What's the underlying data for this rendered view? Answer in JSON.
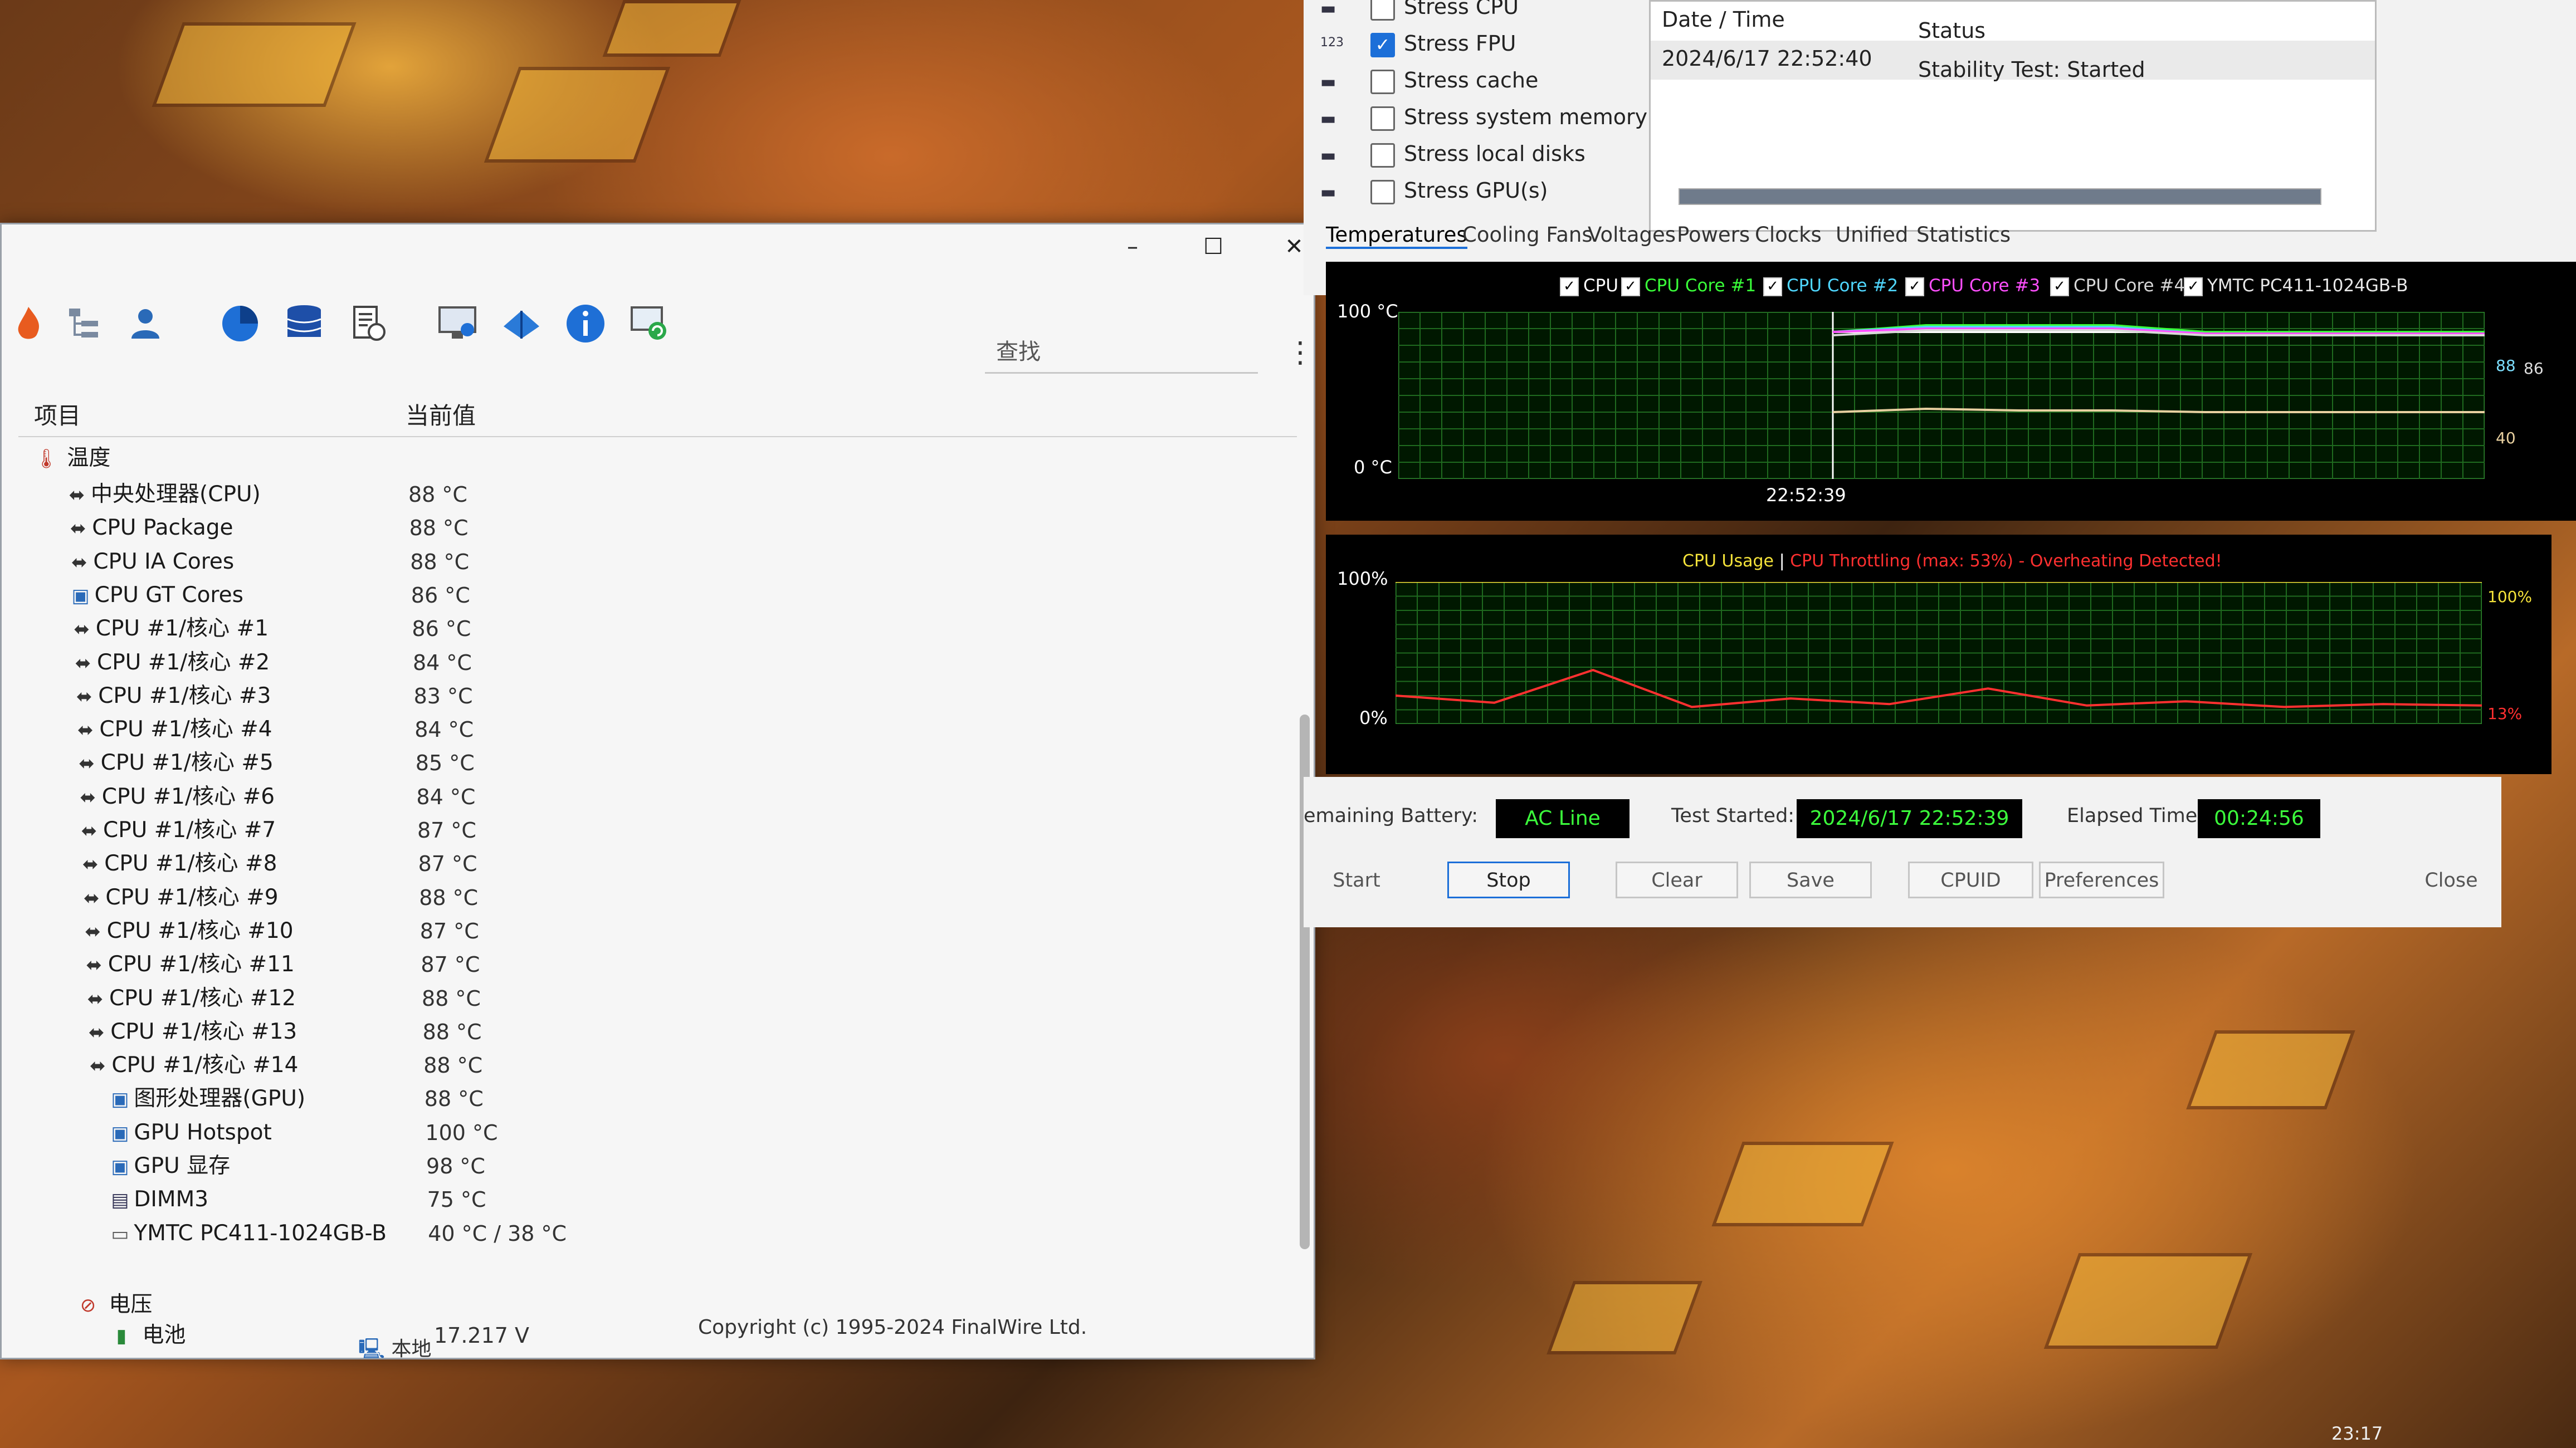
{
  "aida": {
    "search_placeholder": "查找",
    "col_item": "项目",
    "col_value": "当前值",
    "section_temp": "温度",
    "sensors": [
      {
        "label": "中央处理器(CPU)",
        "value": "88 °C",
        "icon": "cpu-icon"
      },
      {
        "label": "CPU Package",
        "value": "88 °C",
        "icon": "cpu-icon"
      },
      {
        "label": "CPU IA Cores",
        "value": "88 °C",
        "icon": "cpu-icon"
      },
      {
        "label": "CPU GT Cores",
        "value": "86 °C",
        "icon": "gpu-icon"
      },
      {
        "label": "CPU #1/核心 #1",
        "value": "86 °C",
        "icon": "cpu-icon"
      },
      {
        "label": "CPU #1/核心 #2",
        "value": "84 °C",
        "icon": "cpu-icon"
      },
      {
        "label": "CPU #1/核心 #3",
        "value": "83 °C",
        "icon": "cpu-icon"
      },
      {
        "label": "CPU #1/核心 #4",
        "value": "84 °C",
        "icon": "cpu-icon"
      },
      {
        "label": "CPU #1/核心 #5",
        "value": "85 °C",
        "icon": "cpu-icon"
      },
      {
        "label": "CPU #1/核心 #6",
        "value": "84 °C",
        "icon": "cpu-icon"
      },
      {
        "label": "CPU #1/核心 #7",
        "value": "87 °C",
        "icon": "cpu-icon"
      },
      {
        "label": "CPU #1/核心 #8",
        "value": "87 °C",
        "icon": "cpu-icon"
      },
      {
        "label": "CPU #1/核心 #9",
        "value": "88 °C",
        "icon": "cpu-icon"
      },
      {
        "label": "CPU #1/核心 #10",
        "value": "87 °C",
        "icon": "cpu-icon"
      },
      {
        "label": "CPU #1/核心 #11",
        "value": "87 °C",
        "icon": "cpu-icon"
      },
      {
        "label": "CPU #1/核心 #12",
        "value": "88 °C",
        "icon": "cpu-icon"
      },
      {
        "label": "CPU #1/核心 #13",
        "value": "88 °C",
        "icon": "cpu-icon"
      },
      {
        "label": "CPU #1/核心 #14",
        "value": "88 °C",
        "icon": "cpu-icon"
      },
      {
        "label": "图形处理器(GPU)",
        "value": "88 °C",
        "icon": "gpu-icon"
      },
      {
        "label": "GPU Hotspot",
        "value": "100 °C",
        "icon": "gpu-icon"
      },
      {
        "label": "GPU 显存",
        "value": "98 °C",
        "icon": "gpu-icon"
      },
      {
        "label": "DIMM3",
        "value": "75 °C",
        "icon": "memory-icon"
      },
      {
        "label": "YMTC PC411-1024GB-B",
        "value": "40 °C / 38 °C",
        "icon": "disk-icon"
      }
    ],
    "section_voltage": "电压",
    "battery_label": "电池",
    "battery_value": "17.217 V",
    "status_local": "本地",
    "copyright": "Copyright (c) 1995-2024 FinalWire Ltd."
  },
  "sst": {
    "stress": [
      {
        "label": "Stress CPU",
        "checked": false
      },
      {
        "label": "Stress FPU",
        "checked": true
      },
      {
        "label": "Stress cache",
        "checked": false
      },
      {
        "label": "Stress system memory",
        "checked": false
      },
      {
        "label": "Stress local disks",
        "checked": false
      },
      {
        "label": "Stress GPU(s)",
        "checked": false
      }
    ],
    "log_col_date": "Date / Time",
    "log_col_status": "Status",
    "log_date": "2024/6/17 22:52:40",
    "log_status": "Stability Test: Started",
    "tabs": [
      "Temperatures",
      "Cooling Fans",
      "Voltages",
      "Powers",
      "Clocks",
      "Unified",
      "Statistics"
    ],
    "temp_legend": [
      {
        "label": "CPU",
        "color": "#ffffff"
      },
      {
        "label": "CPU Core #1",
        "color": "#39ff39"
      },
      {
        "label": "CPU Core #2",
        "color": "#4fd7ff"
      },
      {
        "label": "CPU Core #3",
        "color": "#ff4fff"
      },
      {
        "label": "CPU Core #4",
        "color": "#d8d8d8"
      },
      {
        "label": "YMTC PC411-1024GB-B",
        "color": "#e8e8e8"
      }
    ],
    "temp_y_top": "100 °C",
    "temp_y_bottom": "0 °C",
    "temp_time": "22:52:39",
    "temp_right_88": "88",
    "temp_right_86": "86",
    "temp_right_40": "40",
    "usage_title": "CPU Usage",
    "usage_sep": "|",
    "usage_throttle": "CPU Throttling (max: 53%) - Overheating Detected!",
    "usage_y_top": "100%",
    "usage_y_bottom": "0%",
    "usage_right_top": "100%",
    "usage_right_cur": "13%",
    "remaining_battery_label": "emaining Battery:",
    "remaining_battery_value": "AC Line",
    "test_started_label": "Test Started:",
    "test_started_value": "2024/6/17 22:52:39",
    "elapsed_label": "Elapsed Time:",
    "elapsed_value": "00:24:56",
    "buttons": {
      "start": "Start",
      "stop": "Stop",
      "clear": "Clear",
      "save": "Save",
      "cpuid": "CPUID",
      "preferences": "Preferences",
      "close": "Close"
    }
  },
  "taskbar": {
    "clock": "23:17"
  },
  "chart_data": [
    {
      "type": "line",
      "title": "",
      "xlabel": "",
      "ylabel": "",
      "ylim": [
        0,
        100
      ],
      "x_tick_labels": [
        "22:52:39"
      ],
      "series": [
        {
          "name": "CPU",
          "values": [
            88,
            88,
            88,
            88,
            88,
            88,
            88,
            88
          ]
        },
        {
          "name": "CPU Core #1",
          "values": [
            88,
            92,
            92,
            92,
            88,
            88,
            88,
            88
          ]
        },
        {
          "name": "CPU Core #2",
          "values": [
            88,
            91,
            91,
            91,
            87,
            87,
            86,
            86
          ]
        },
        {
          "name": "CPU Core #3",
          "values": [
            88,
            90,
            90,
            90,
            87,
            87,
            87,
            87
          ]
        },
        {
          "name": "CPU Core #4",
          "values": [
            86,
            89,
            89,
            89,
            86,
            86,
            86,
            86
          ]
        },
        {
          "name": "YMTC PC411-1024GB-B",
          "values": [
            40,
            42,
            41,
            41,
            40,
            40,
            40,
            40
          ]
        }
      ]
    },
    {
      "type": "line",
      "title": "CPU Usage",
      "ylim": [
        0,
        100
      ],
      "series": [
        {
          "name": "CPU Usage",
          "values": [
            100,
            100,
            100,
            100,
            100,
            100,
            100,
            100
          ]
        },
        {
          "name": "CPU Throttling",
          "values": [
            20,
            15,
            38,
            12,
            18,
            14,
            25,
            13,
            16,
            12,
            14,
            13
          ]
        }
      ]
    }
  ]
}
